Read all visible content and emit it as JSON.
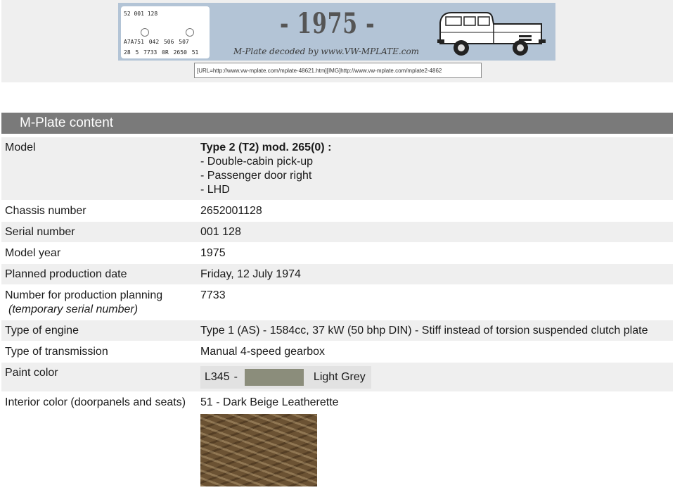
{
  "banner": {
    "plate_line1": "52 001 128",
    "plate_line2": "A7A751  042 506 507",
    "plate_line3": "28 5 7733  0R  2650 51",
    "year_text": "- 1975 -",
    "decoded_by": "M-Plate decoded by www.VW-MPLATE.com",
    "background_color": "#b3c4d6"
  },
  "embed_code": "[URL=http://www.vw-mplate.com/mplate-48621.htm][IMG]http://www.vw-mplate.com/mplate2-4862",
  "section_title": "M-Plate content",
  "rows": {
    "model": {
      "label": "Model",
      "value_title": "Type 2 (T2) mod. 265(0) :",
      "line1": "- Double-cabin pick-up",
      "line2": "- Passenger door right",
      "line3": "- LHD"
    },
    "chassis": {
      "label": "Chassis number",
      "value": "2652001128"
    },
    "serial": {
      "label": "Serial number",
      "value": "001 128"
    },
    "model_year": {
      "label": "Model year",
      "value": "1975"
    },
    "production_date": {
      "label": "Planned production date",
      "value": "Friday, 12 July 1974"
    },
    "planning_number": {
      "label": "Number for production planning",
      "sublabel": "(temporary serial number)",
      "value": "7733"
    },
    "engine": {
      "label": "Type of engine",
      "value": "Type 1 (AS) - 1584cc, 37 kW (50 bhp DIN) - Stiff instead of torsion suspended clutch plate"
    },
    "transmission": {
      "label": "Type of transmission",
      "value": "Manual 4-speed gearbox"
    },
    "paint": {
      "label": "Paint color",
      "code": "L345",
      "separator": "-",
      "name": "Light Grey",
      "swatch_color": "#8b8d7b"
    },
    "interior": {
      "label": "Interior color (doorpanels and seats)",
      "value": "51 - Dark Beige Leatherette"
    }
  },
  "colors": {
    "header_bg": "#7a7a7a",
    "row_alt_bg": "#efefef"
  }
}
